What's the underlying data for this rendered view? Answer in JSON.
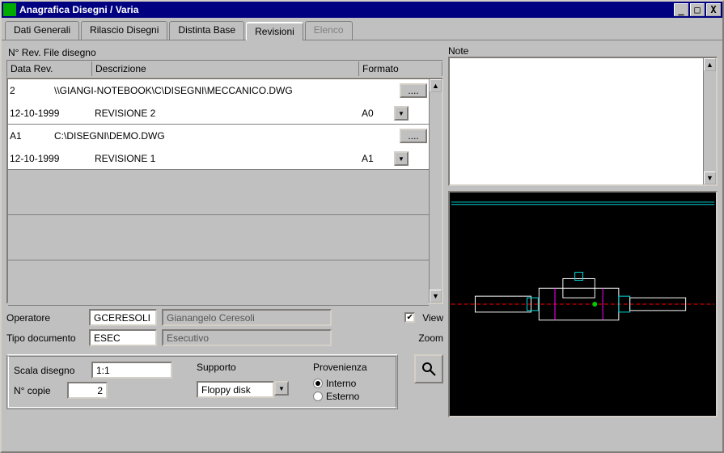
{
  "window": {
    "title": "Anagrafica Disegni / Varia"
  },
  "tabs": [
    {
      "label": "Dati Generali",
      "active": false
    },
    {
      "label": "Rilascio Disegni",
      "active": false
    },
    {
      "label": "Distinta Base",
      "active": false
    },
    {
      "label": "Revisioni",
      "active": true
    },
    {
      "label": "Elenco",
      "disabled": true
    }
  ],
  "list_header": {
    "left": "N° Rev.  File disegno",
    "data_rev": "Data Rev.",
    "descrizione": "Descrizione",
    "formato": "Formato"
  },
  "rows": [
    {
      "rev": "2",
      "file": "\\\\GIANGI-NOTEBOOK\\C\\DISEGNI\\MECCANICO.DWG",
      "data": "12-10-1999",
      "descr": "REVISIONE 2",
      "formato": "A0"
    },
    {
      "rev": "A1",
      "file": "C:\\DISEGNI\\DEMO.DWG",
      "data": "12-10-1999",
      "descr": "REVISIONE 1",
      "formato": "A1"
    }
  ],
  "labels": {
    "note": "Note",
    "operatore": "Operatore",
    "tipo_documento": "Tipo documento",
    "view": "View",
    "zoom": "Zoom",
    "scala_disegno": "Scala disegno",
    "n_copie": "N° copie",
    "supporto": "Supporto",
    "provenienza": "Provenienza",
    "interno": "Interno",
    "esterno": "Esterno"
  },
  "fields": {
    "operatore_code": "GCERESOLI",
    "operatore_name": "Gianangelo Ceresoli",
    "tipo_doc_code": "ESEC",
    "tipo_doc_name": "Esecutivo",
    "view_checked": true,
    "scala": "1:1",
    "copie": "2",
    "supporto": "Floppy disk",
    "provenienza": "Interno"
  },
  "winbtns": {
    "min": "_",
    "max": "□",
    "close": "X"
  },
  "icons": {
    "ellipsis": "....",
    "dropdown": "▼",
    "up": "▲",
    "zoom": "🔍",
    "check": "✔"
  }
}
